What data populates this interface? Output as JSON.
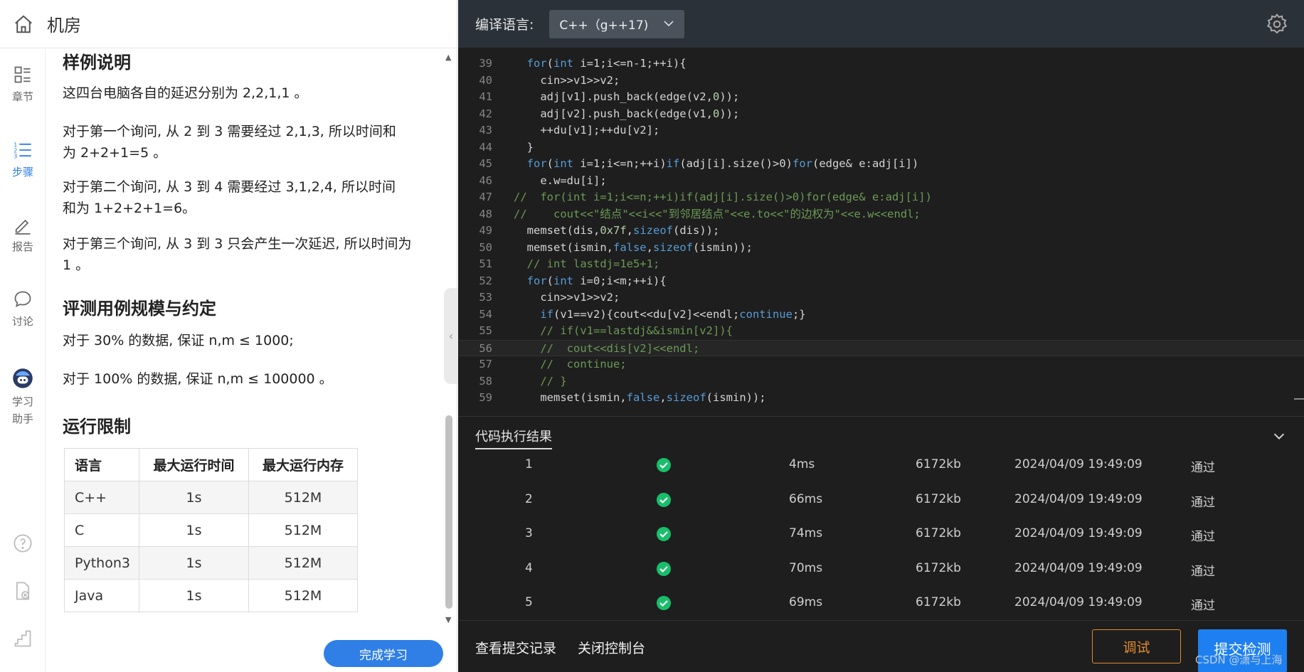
{
  "header": {
    "title": "机房"
  },
  "sidenav": {
    "items": [
      {
        "label": "章节"
      },
      {
        "label": "步骤"
      },
      {
        "label": "报告"
      },
      {
        "label": "讨论"
      },
      {
        "label": "学习\n助手"
      }
    ]
  },
  "content": {
    "sample_heading": "样例说明",
    "p1": "这四台电脑各自的延迟分别为 2,2,1,1 。",
    "p2_line1": "对于第一个询问, 从 2 到 3 需要经过 2,1,3, 所以时间和",
    "p2_line2": "为 2+2+1=5 。",
    "p3_line1": "对于第二个询问, 从 3 到 4 需要经过 3,1,2,4, 所以时间",
    "p3_line2": "和为 1+2+2+1=6。",
    "p4_line1": "对于第三个询问, 从 3 到 3 只会产生一次延迟, 所以时间为",
    "p4_line2": "1 。",
    "scale_heading": "评测用例规模与约定",
    "s1": "对于 30% 的数据, 保证 n,m ≤ 1000;",
    "s2": "对于 100% 的数据, 保证 n,m ≤ 100000 。",
    "limit_heading": "运行限制",
    "limits_table": {
      "headers": [
        "语言",
        "最大运行时间",
        "最大运行内存"
      ],
      "rows": [
        [
          "C++",
          "1s",
          "512M"
        ],
        [
          "C",
          "1s",
          "512M"
        ],
        [
          "Python3",
          "1s",
          "512M"
        ],
        [
          "Java",
          "1s",
          "512M"
        ]
      ]
    },
    "finish_button": "完成学习"
  },
  "editor_toolbar": {
    "language_label": "编译语言:",
    "language_value": "C++（g++17)"
  },
  "code_lines": [
    {
      "n": "39",
      "html": "  <span class='kw'>for</span>(<span class='kw'>int</span> i=1;i&lt;=n-1;++i){"
    },
    {
      "n": "40",
      "html": "    cin&gt;&gt;v1&gt;&gt;v2;"
    },
    {
      "n": "41",
      "html": "    adj[v1].push_back(edge(v2,<span class='num'>0</span>));"
    },
    {
      "n": "42",
      "html": "    adj[v2].push_back(edge(v1,<span class='num'>0</span>));"
    },
    {
      "n": "43",
      "html": "    ++du[v1];++du[v2];"
    },
    {
      "n": "44",
      "html": "  }"
    },
    {
      "n": "45",
      "html": "  <span class='kw'>for</span>(<span class='kw'>int</span> i=1;i&lt;=n;++i)<span class='kw'>if</span>(adj[i].size()&gt;0)<span class='kw'>for</span>(edge&amp; e:adj[i])"
    },
    {
      "n": "46",
      "html": "    e.w=du[i];"
    },
    {
      "n": "47",
      "html": "<span class='com'>//  for(int i=1;i&lt;=n;++i)if(adj[i].size()&gt;0)for(edge&amp; e:adj[i])</span>"
    },
    {
      "n": "48",
      "html": "<span class='com'>//    cout&lt;&lt;\"结点\"&lt;&lt;i&lt;&lt;\"到邻居结点\"&lt;&lt;e.to&lt;&lt;\"的边权为\"&lt;&lt;e.w&lt;&lt;endl;</span>"
    },
    {
      "n": "49",
      "html": "  memset(dis,<span class='num'>0x7f</span>,<span class='kw'>sizeof</span>(dis));"
    },
    {
      "n": "50",
      "html": "  memset(ismin,<span class='kw'>false</span>,<span class='kw'>sizeof</span>(ismin));"
    },
    {
      "n": "51",
      "html": "  <span class='com'>// int lastdj=1e5+1;</span>"
    },
    {
      "n": "52",
      "html": "  <span class='kw'>for</span>(<span class='kw'>int</span> i=0;i&lt;m;++i){"
    },
    {
      "n": "53",
      "html": "    cin&gt;&gt;v1&gt;&gt;v2;"
    },
    {
      "n": "54",
      "html": "    <span class='kw'>if</span>(v1==v2){cout&lt;&lt;du[v2]&lt;&lt;endl;<span class='kw'>continue</span>;}"
    },
    {
      "n": "55",
      "html": "    <span class='com'>// if(v1==lastdj&amp;&amp;ismin[v2]){</span>"
    },
    {
      "n": "56",
      "html": "    <span class='com'>//  cout&lt;&lt;dis[v2]&lt;&lt;endl;</span>"
    },
    {
      "n": "57",
      "html": "    <span class='com'>//  continue;</span>"
    },
    {
      "n": "58",
      "html": "    <span class='com'>// }</span>"
    },
    {
      "n": "59",
      "html": "    memset(ismin,<span class='kw'>false</span>,<span class='kw'>sizeof</span>(ismin));"
    }
  ],
  "results": {
    "title": "代码执行结果",
    "rows": [
      {
        "id": "1",
        "time": "4ms",
        "mem": "6172kb",
        "date": "2024/04/09 19:49:09",
        "status": "通过"
      },
      {
        "id": "2",
        "time": "66ms",
        "mem": "6172kb",
        "date": "2024/04/09 19:49:09",
        "status": "通过"
      },
      {
        "id": "3",
        "time": "74ms",
        "mem": "6172kb",
        "date": "2024/04/09 19:49:09",
        "status": "通过"
      },
      {
        "id": "4",
        "time": "70ms",
        "mem": "6172kb",
        "date": "2024/04/09 19:49:09",
        "status": "通过"
      },
      {
        "id": "5",
        "time": "69ms",
        "mem": "6172kb",
        "date": "2024/04/09 19:49:09",
        "status": "通过"
      }
    ]
  },
  "bottombar": {
    "view_records": "查看提交记录",
    "close_console": "关闭控制台",
    "debug": "调试",
    "submit": "提交检测",
    "watermark": "CSDN @潇与上海"
  },
  "colors": {
    "accent": "#2f7fe6",
    "pass": "#19be6b",
    "debug": "#e28a2d"
  }
}
